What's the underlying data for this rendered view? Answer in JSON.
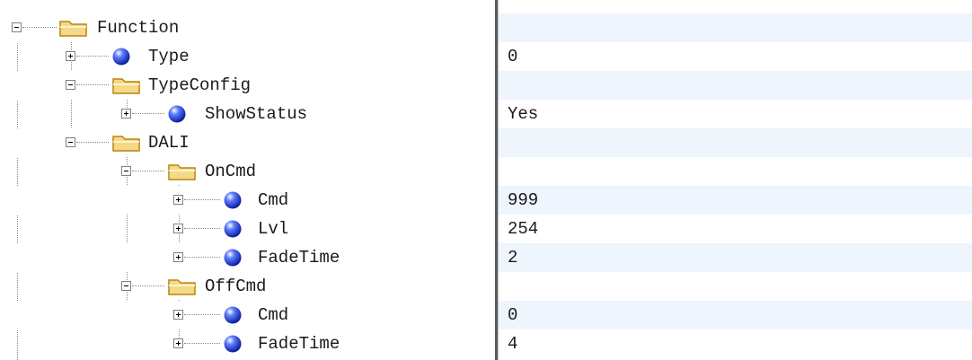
{
  "tree": {
    "function": {
      "label": "Function",
      "value": ""
    },
    "type": {
      "label": "Type",
      "value": "0"
    },
    "type_config": {
      "label": "TypeConfig",
      "value": ""
    },
    "show_status": {
      "label": "ShowStatus",
      "value": "Yes"
    },
    "dali": {
      "label": "DALI",
      "value": ""
    },
    "on_cmd": {
      "label": "OnCmd",
      "value": ""
    },
    "on_cmd_cmd": {
      "label": "Cmd",
      "value": "999"
    },
    "on_cmd_lvl": {
      "label": "Lvl",
      "value": "254"
    },
    "on_cmd_fade_time": {
      "label": "FadeTime",
      "value": "2"
    },
    "off_cmd": {
      "label": "OffCmd",
      "value": ""
    },
    "off_cmd_cmd": {
      "label": "Cmd",
      "value": "0"
    },
    "off_cmd_fade_time": {
      "label": "FadeTime",
      "value": "4"
    }
  },
  "icons": {
    "folder": "folder-icon",
    "property": "property-ball-icon",
    "expand": "plus-expander-icon",
    "collapse": "minus-expander-icon"
  },
  "colors": {
    "folder_fill": "#f5d98a",
    "folder_stroke": "#b8860b",
    "property_ball": "#1f3fd6",
    "alt_row": "#eef5fd",
    "divider": "#5a5a5a"
  }
}
